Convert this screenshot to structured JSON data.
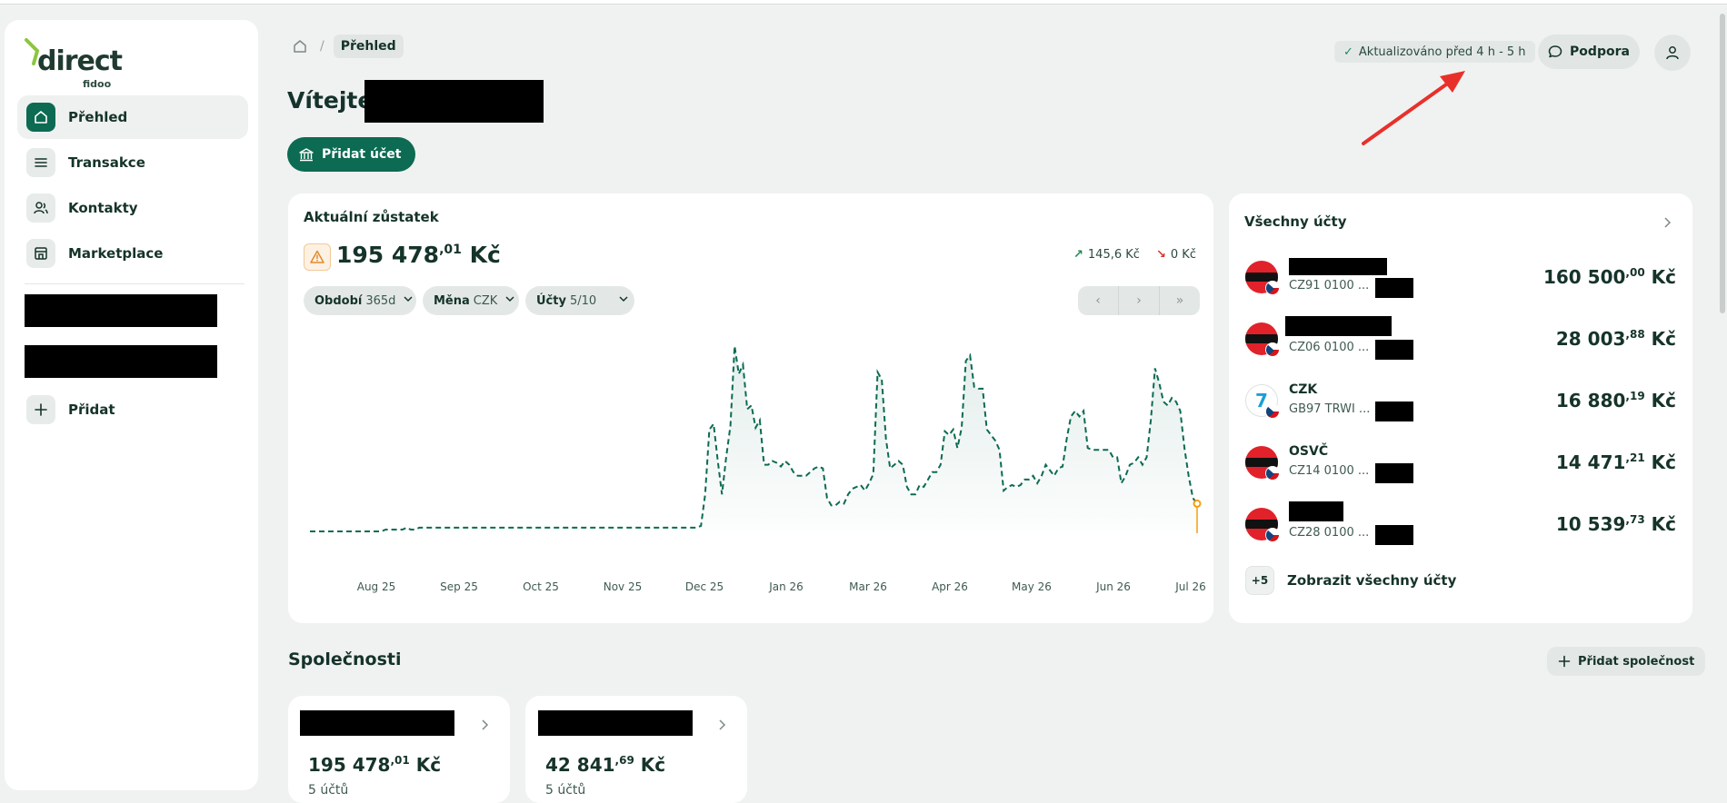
{
  "brand": {
    "logo_text": "direct",
    "logo_sub": "fidoo",
    "accent": "#0c6b52"
  },
  "sidebar": {
    "items": [
      {
        "label": "Přehled",
        "icon": "home-icon",
        "active": true
      },
      {
        "label": "Transakce",
        "icon": "list-icon",
        "active": false
      },
      {
        "label": "Kontakty",
        "icon": "contacts-icon",
        "active": false
      },
      {
        "label": "Marketplace",
        "icon": "store-icon",
        "active": false
      }
    ],
    "add_label": "Přidat"
  },
  "header": {
    "breadcrumb_current": "Přehled",
    "updated": "Aktualizováno před 4 h - 5 h",
    "support": "Podpora"
  },
  "welcome": "Vítejte,",
  "add_account": "Přidat účet",
  "balance": {
    "title": "Aktuální zůstatek",
    "amount_main": "195 478",
    "amount_dec": ",01",
    "currency": "Kč",
    "incoming": "145,6 Kč",
    "outgoing": "0 Kč",
    "filters": [
      {
        "key": "Období",
        "value": "365d"
      },
      {
        "key": "Měna",
        "value": "CZK"
      },
      {
        "key": "Účty",
        "value": "5/10"
      }
    ]
  },
  "chart_data": {
    "type": "area",
    "x_ticks": [
      "Aug 25",
      "Sep 25",
      "Oct 25",
      "Nov 25",
      "Dec 25",
      "Jan 26",
      "Mar 26",
      "Apr 26",
      "May 26",
      "Jun 26",
      "Jul 26"
    ],
    "series_color": "#0c6b52",
    "values": [
      0.0,
      0.0,
      0.0,
      0.0,
      0.0,
      0.0,
      0.0,
      0.0,
      0.0,
      0.0,
      0.0,
      0.0,
      0.0,
      0.0,
      0.0,
      0.0,
      0.0,
      0.0,
      0.01,
      0.01,
      0.01,
      0.01,
      0.01,
      0.02,
      0.01,
      0.01,
      0.02,
      0.02,
      0.02,
      0.02,
      0.02,
      0.02,
      0.02,
      0.02,
      0.02,
      0.02,
      0.02,
      0.02,
      0.02,
      0.02,
      0.02,
      0.02,
      0.02,
      0.02,
      0.02,
      0.02,
      0.02,
      0.02,
      0.02,
      0.02,
      0.02,
      0.02,
      0.02,
      0.02,
      0.02,
      0.02,
      0.02,
      0.02,
      0.02,
      0.02,
      0.02,
      0.02,
      0.02,
      0.02,
      0.02,
      0.02,
      0.02,
      0.02,
      0.02,
      0.02,
      0.02,
      0.02,
      0.02,
      0.02,
      0.02,
      0.02,
      0.02,
      0.02,
      0.02,
      0.02,
      0.02,
      0.02,
      0.02,
      0.02,
      0.02,
      0.02,
      0.02,
      0.02,
      0.02,
      0.02,
      0.02,
      0.02,
      0.02,
      0.03,
      0.2,
      0.55,
      0.58,
      0.38,
      0.2,
      0.4,
      0.57,
      1.0,
      0.85,
      0.9,
      0.66,
      0.68,
      0.56,
      0.6,
      0.36,
      0.36,
      0.38,
      0.37,
      0.35,
      0.38,
      0.36,
      0.32,
      0.3,
      0.3,
      0.3,
      0.32,
      0.34,
      0.35,
      0.34,
      0.18,
      0.14,
      0.14,
      0.16,
      0.15,
      0.2,
      0.23,
      0.24,
      0.25,
      0.22,
      0.26,
      0.31,
      0.86,
      0.82,
      0.5,
      0.34,
      0.36,
      0.38,
      0.36,
      0.24,
      0.2,
      0.2,
      0.25,
      0.24,
      0.28,
      0.32,
      0.32,
      0.36,
      0.54,
      0.52,
      0.55,
      0.45,
      0.56,
      0.92,
      0.95,
      0.78,
      0.77,
      0.77,
      0.55,
      0.52,
      0.49,
      0.44,
      0.22,
      0.24,
      0.25,
      0.24,
      0.25,
      0.28,
      0.28,
      0.3,
      0.26,
      0.3,
      0.36,
      0.33,
      0.3,
      0.34,
      0.35,
      0.5,
      0.62,
      0.65,
      0.62,
      0.65,
      0.45,
      0.44,
      0.44,
      0.44,
      0.44,
      0.44,
      0.4,
      0.4,
      0.26,
      0.3,
      0.36,
      0.37,
      0.4,
      0.36,
      0.4,
      0.6,
      0.88,
      0.8,
      0.7,
      0.68,
      0.72,
      0.7,
      0.65,
      0.45,
      0.3,
      0.18,
      0.15
    ],
    "end_marker_color": "#f59e0b"
  },
  "accounts": {
    "title": "Všechny účty",
    "items": [
      {
        "name": "",
        "iban": "CZ91 0100 ...",
        "amount_main": "160 500",
        "amount_dec": ",00",
        "logo": "bank-red"
      },
      {
        "name": "",
        "iban": "CZ06 0100 ...",
        "amount_main": "28 003",
        "amount_dec": ",88",
        "logo": "bank-red"
      },
      {
        "name": "CZK",
        "iban": "GB97 TRWI ...",
        "amount_main": "16 880",
        "amount_dec": ",19",
        "logo": "wise"
      },
      {
        "name": "OSVČ",
        "iban": "CZ14 0100 ...",
        "amount_main": "14 471",
        "amount_dec": ",21",
        "logo": "bank-red"
      },
      {
        "name": "",
        "iban": "CZ28 0100 ...",
        "amount_main": "10 539",
        "amount_dec": ",73",
        "logo": "bank-red"
      }
    ],
    "currency": "Kč",
    "more_badge": "+5",
    "more_label": "Zobrazit všechny účty"
  },
  "companies": {
    "title": "Společnosti",
    "add_label": "Přidat společnost",
    "items": [
      {
        "amount_main": "195 478",
        "amount_dec": ",01",
        "accounts": "5 účtů"
      },
      {
        "amount_main": "42 841",
        "amount_dec": ",69",
        "accounts": "5 účtů"
      }
    ]
  }
}
